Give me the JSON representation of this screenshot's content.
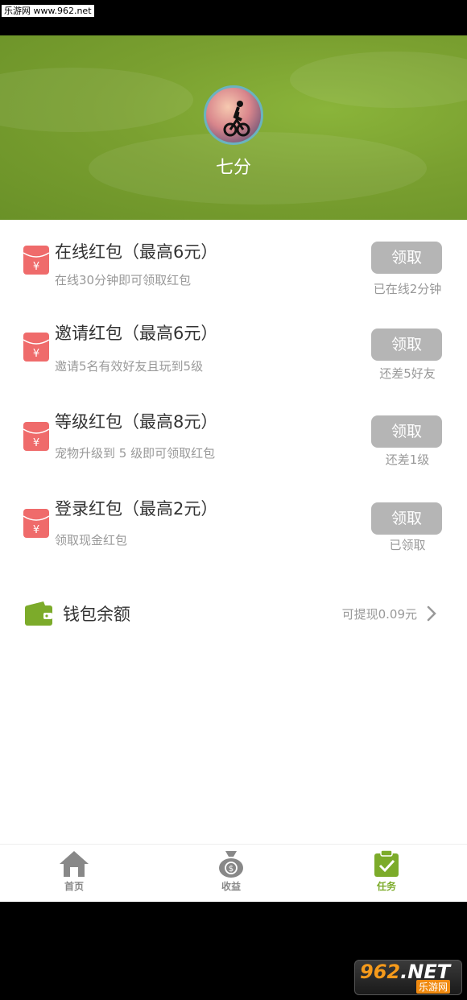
{
  "watermark": "乐游网 www.962.net",
  "profile": {
    "username": "七分"
  },
  "tasks": [
    {
      "title": "在线红包（最高6元）",
      "desc": "在线30分钟即可领取红包",
      "button": "领取",
      "status": "已在线2分钟"
    },
    {
      "title": "邀请红包（最高6元）",
      "desc": "邀请5名有效好友且玩到5级",
      "button": "领取",
      "status": "还差5好友"
    },
    {
      "title": "等级红包（最高8元）",
      "desc": "宠物升级到 5 级即可领取红包",
      "button": "领取",
      "status": "还差1级"
    },
    {
      "title": "登录红包（最高2元）",
      "desc": "领取现金红包",
      "button": "领取",
      "status": "已领取"
    }
  ],
  "wallet": {
    "label": "钱包余额",
    "value": "可提现0.09元"
  },
  "tabs": [
    {
      "label": "首页",
      "icon": "home-icon"
    },
    {
      "label": "收益",
      "icon": "money-bag-icon"
    },
    {
      "label": "任务",
      "icon": "clipboard-check-icon",
      "active": true
    }
  ],
  "logo": {
    "text_main": "962",
    "text_suffix": ".NET",
    "text_sub": "乐游网"
  },
  "colors": {
    "accent": "#7cab2a",
    "header_bg": "#7aa030",
    "red_packet": "#ef6b6b",
    "button_disabled": "#b5b5b5"
  }
}
